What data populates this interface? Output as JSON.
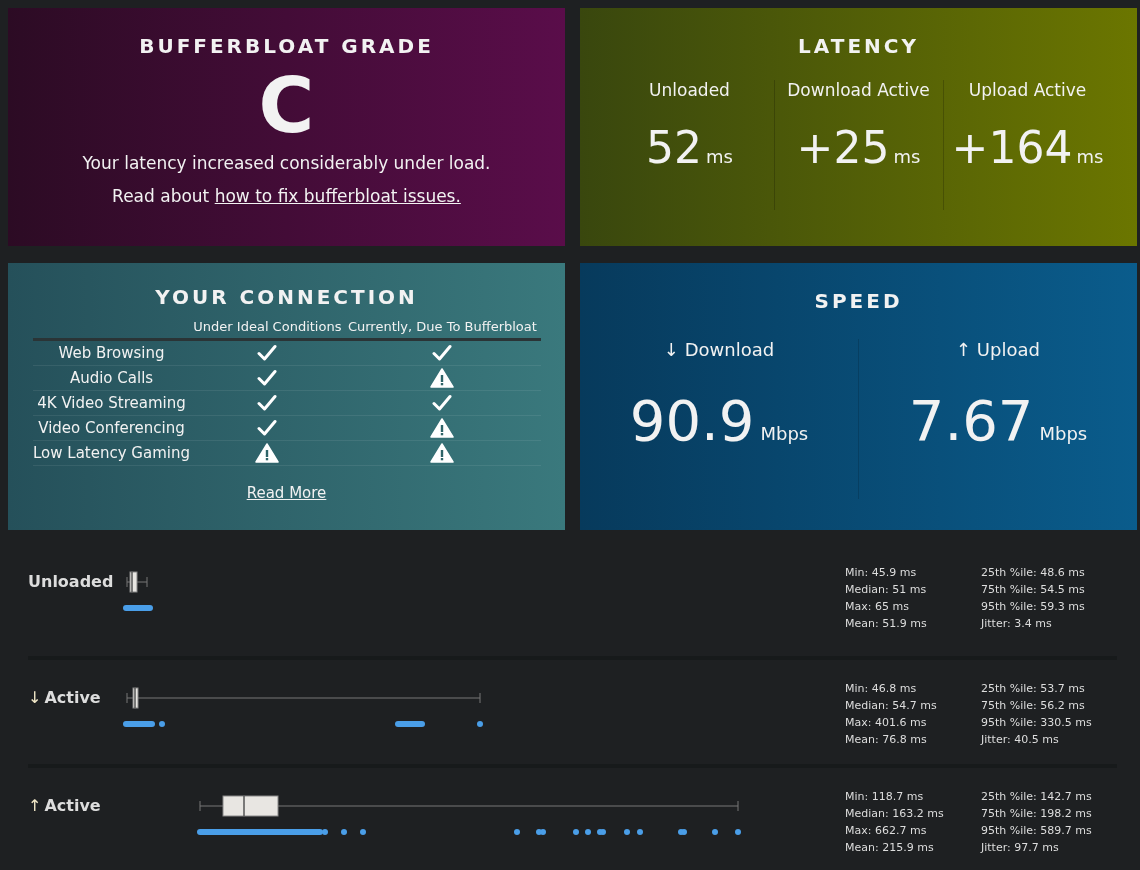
{
  "grade": {
    "title": "BUFFERBLOAT GRADE",
    "letter": "C",
    "message": "Your latency increased considerably under load.",
    "link_prefix": "Read about",
    "link": "how to fix bufferbloat issues."
  },
  "latency": {
    "title": "LATENCY",
    "items": [
      {
        "label": "Unloaded",
        "value": "52",
        "unit": "ms"
      },
      {
        "label": "Download Active",
        "value": "+25",
        "unit": "ms"
      },
      {
        "label": "Upload Active",
        "value": "+164",
        "unit": "ms"
      }
    ]
  },
  "connection": {
    "title": "YOUR CONNECTION",
    "columns": [
      "Under Ideal Conditions",
      "Currently, Due To Bufferbloat"
    ],
    "rows": [
      {
        "name": "Web Browsing",
        "ideal_ok": true,
        "current_ok": true
      },
      {
        "name": "Audio Calls",
        "ideal_ok": true,
        "current_ok": false
      },
      {
        "name": "4K Video Streaming",
        "ideal_ok": true,
        "current_ok": true
      },
      {
        "name": "Video Conferencing",
        "ideal_ok": true,
        "current_ok": false
      },
      {
        "name": "Low Latency Gaming",
        "ideal_ok": false,
        "current_ok": false
      }
    ],
    "link": "Read More"
  },
  "speed": {
    "title": "SPEED",
    "items": [
      {
        "arrow": "↓",
        "label": "Download",
        "value": "90.9",
        "unit": "Mbps"
      },
      {
        "arrow": "↑",
        "label": "Upload",
        "value": "7.67",
        "unit": "Mbps"
      }
    ]
  },
  "latency_plots": [
    {
      "label": "Unloaded",
      "stats_left": [
        "Min: 45.9 ms",
        "Median: 51 ms",
        "Max: 65 ms",
        "Mean: 51.9 ms"
      ],
      "stats_right": [
        "25th %ile: 48.6 ms",
        "75th %ile: 54.5 ms",
        "95th %ile: 59.3 ms",
        "Jitter: 3.4 ms"
      ]
    },
    {
      "arrow": "↓",
      "label": "Active",
      "stats_left": [
        "Min: 46.8 ms",
        "Median: 54.7 ms",
        "Max: 401.6 ms",
        "Mean: 76.8 ms"
      ],
      "stats_right": [
        "25th %ile: 53.7 ms",
        "75th %ile: 56.2 ms",
        "95th %ile: 330.5 ms",
        "Jitter: 40.5 ms"
      ]
    },
    {
      "arrow": "↑",
      "label": "Active",
      "stats_left": [
        "Min: 118.7 ms",
        "Median: 163.2 ms",
        "Max: 662.7 ms",
        "Mean: 215.9 ms"
      ],
      "stats_right": [
        "25th %ile: 142.7 ms",
        "75th %ile: 198.2 ms",
        "95th %ile: 589.7 ms",
        "Jitter: 97.7 ms"
      ]
    }
  ]
}
